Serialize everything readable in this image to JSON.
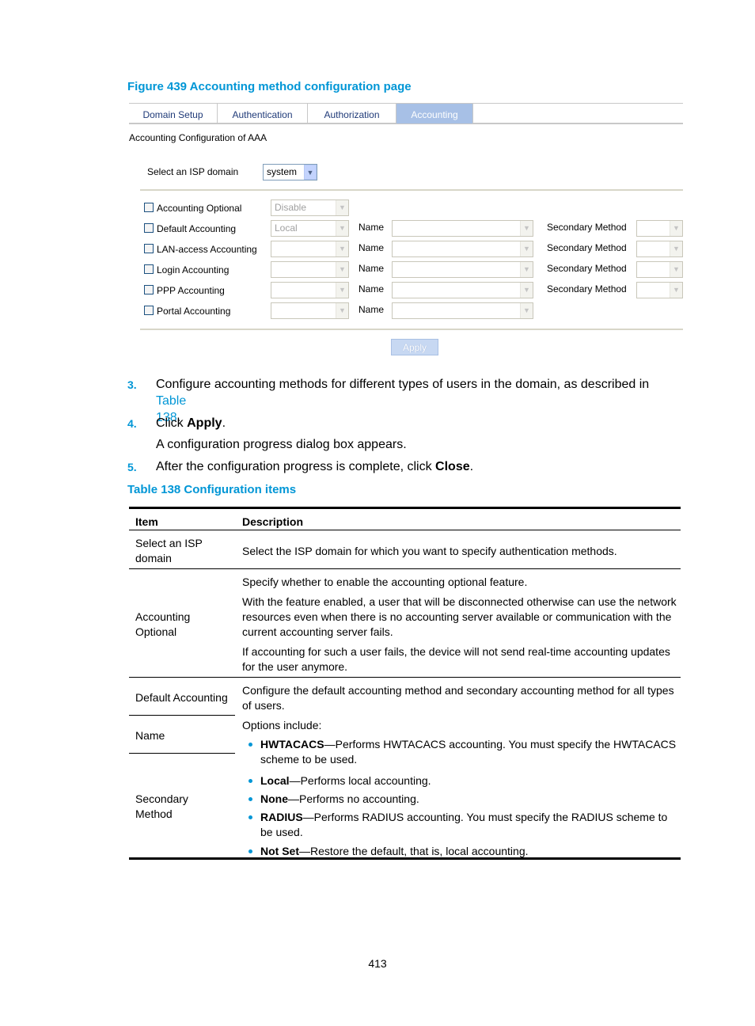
{
  "figure_caption": "Figure 439 Accounting method configuration page",
  "ui": {
    "tabs": [
      {
        "label": "Domain Setup",
        "active": false
      },
      {
        "label": "Authentication",
        "active": false
      },
      {
        "label": "Authorization",
        "active": false
      },
      {
        "label": "Accounting",
        "active": true
      }
    ],
    "section_title": "Accounting Configuration of AAA",
    "isp_domain_label": "Select an ISP domain",
    "isp_domain_value": "system",
    "rows": [
      {
        "label": "Accounting Optional",
        "checked": false,
        "method": "Disable",
        "name_label": "",
        "secondary_label": ""
      },
      {
        "label": "Default Accounting",
        "checked": false,
        "method": "Local",
        "name_label": "Name",
        "secondary_label": "Secondary Method"
      },
      {
        "label": "LAN-access Accounting",
        "checked": false,
        "method": "",
        "name_label": "Name",
        "secondary_label": "Secondary Method"
      },
      {
        "label": "Login Accounting",
        "checked": false,
        "method": "",
        "name_label": "Name",
        "secondary_label": "Secondary Method"
      },
      {
        "label": "PPP Accounting",
        "checked": false,
        "method": "",
        "name_label": "Name",
        "secondary_label": "Secondary Method"
      },
      {
        "label": "Portal Accounting",
        "checked": false,
        "method": "",
        "name_label": "Name",
        "secondary_label": ""
      }
    ],
    "apply_label": "Apply"
  },
  "steps": [
    {
      "num": "3.",
      "text": "Configure accounting methods for different types of users in the domain, as described in ",
      "link": "Table 138",
      "link_line1": "Table",
      "link_line2": "138",
      "tail": "."
    },
    {
      "num": "4.",
      "text_pre": "Click ",
      "bold": "Apply",
      "text_post": ".",
      "sub": "A configuration progress dialog box appears."
    },
    {
      "num": "5.",
      "text_pre": "After the configuration progress is complete, click ",
      "bold": "Close",
      "text_post": "."
    }
  ],
  "table_caption": "Table 138 Configuration items",
  "table": {
    "headers": [
      "Item",
      "Description"
    ],
    "rows": [
      {
        "item": [
          "Select an ISP",
          "domain"
        ],
        "desc": "Select the ISP domain for which you want to specify authentication methods."
      },
      {
        "item": [
          "Accounting",
          "Optional"
        ],
        "desc_paras": [
          "Specify whether to enable the accounting optional feature.",
          "With the feature enabled, a user that will be disconnected otherwise can use the network resources even when there is no accounting server available or communication with the current accounting server fails.",
          "If accounting for such a user fails, the device will not send real-time accounting updates for the user anymore."
        ]
      },
      {
        "item": [
          "Default Accounting"
        ],
        "desc": "Configure the default accounting method and secondary accounting method for all types of users."
      },
      {
        "item": [
          "Name"
        ]
      },
      {
        "item": [
          "Secondary",
          "Method"
        ]
      }
    ],
    "options_intro": "Options include:",
    "options": [
      {
        "term": "HWTACACS",
        "text": "—Performs HWTACACS accounting. You must specify the HWTACACS scheme to be used."
      },
      {
        "term": "Local",
        "text": "—Performs local accounting."
      },
      {
        "term": "None",
        "text": "—Performs no accounting."
      },
      {
        "term": "RADIUS",
        "text": "—Performs RADIUS accounting. You must specify the RADIUS scheme to be used."
      },
      {
        "term": "Not Set",
        "text": "—Restore the default, that is, local accounting."
      }
    ]
  },
  "page_number": "413"
}
